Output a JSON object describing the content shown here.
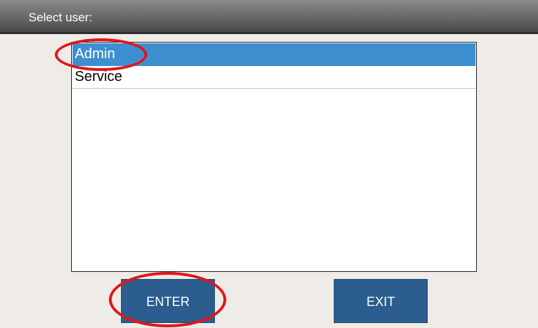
{
  "header": {
    "title": "Select user:"
  },
  "user_list": {
    "items": [
      {
        "label": "Admin",
        "selected": true
      },
      {
        "label": "Service",
        "selected": false
      }
    ]
  },
  "buttons": {
    "enter_label": "ENTER",
    "exit_label": "EXIT"
  },
  "annotations": {
    "circled_items": [
      "Admin",
      "ENTER"
    ],
    "color": "#e0161b"
  },
  "colors": {
    "selection": "#3d8fd0",
    "button": "#2b5d8f",
    "background": "#efebe6"
  }
}
